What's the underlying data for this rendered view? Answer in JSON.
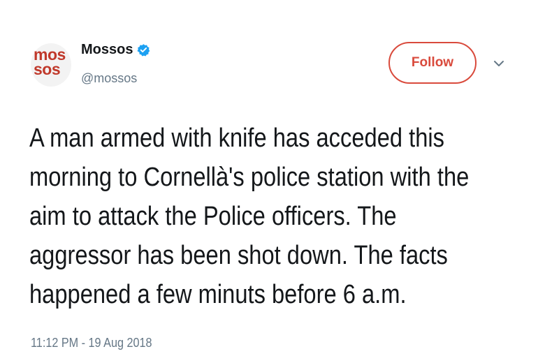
{
  "account": {
    "avatar_text_line1": "mos",
    "avatar_text_line2": "sos",
    "name": "Mossos",
    "handle": "@mossos",
    "verified": true,
    "verified_icon": "verified-badge-icon"
  },
  "actions": {
    "follow_label": "Follow",
    "more_icon": "chevron-down-icon"
  },
  "tweet": {
    "lines": [
      "A man armed with knife has acceded this",
      "morning to Cornellà's police station with the",
      "aim to attack the Police officers. The",
      "aggressor has been shot down. The facts",
      "happened a few minuts before 6 a.m."
    ],
    "timestamp": "11:12 PM - 19 Aug 2018"
  },
  "colors": {
    "brand_red": "#d94a3c",
    "verified_blue": "#1da1f2",
    "text": "#14171a",
    "muted": "#657786"
  }
}
